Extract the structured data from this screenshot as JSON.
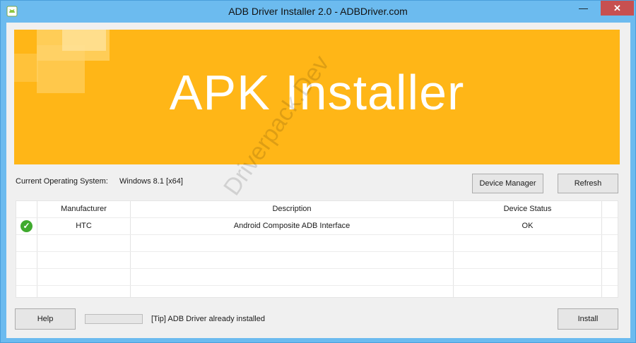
{
  "window": {
    "title": "ADB Driver Installer 2.0 - ADBDriver.com",
    "minimize_glyph": "—",
    "close_glyph": "✕",
    "accent_color": "#6cbbef",
    "close_color": "#c75050"
  },
  "banner": {
    "title": "APK Installer",
    "color": "#ffb617"
  },
  "watermark": "Driverpack.Dev",
  "system": {
    "label": "Current Operating System:",
    "value": "Windows 8.1  [x64]"
  },
  "buttons": {
    "device_manager": "Device Manager",
    "refresh": "Refresh",
    "help": "Help",
    "install": "Install"
  },
  "table": {
    "columns": [
      "",
      "Manufacturer",
      "Description",
      "Device Status",
      ""
    ],
    "rows": [
      {
        "status_icon": "check-icon",
        "manufacturer": "HTC",
        "description": "Android Composite ADB Interface",
        "device_status": "OK"
      }
    ]
  },
  "progress": {
    "value": 0
  },
  "tip": "[Tip] ADB Driver already installed"
}
